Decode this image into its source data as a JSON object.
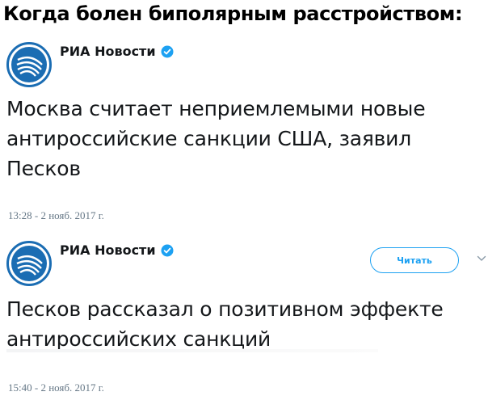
{
  "caption": "Когда болен биполярным расстройством:",
  "tweets": [
    {
      "author": "РИА Новости",
      "text": "Москва считает неприемлемыми новые антироссийские санкции США, заявил Песков",
      "timestamp": "13:28 - 2 нояб. 2017 г."
    },
    {
      "author": "РИА Новости",
      "text": "Песков рассказал о позитивном эффекте антироссийских санкций",
      "timestamp": "15:40 - 2 нояб. 2017 г.",
      "follow_label": "Читать"
    }
  ],
  "icons": {
    "avatar": "ria-novosti-logo-icon",
    "verified": "verified-badge-icon",
    "chevron": "chevron-down-icon"
  },
  "colors": {
    "logo_blue": "#1b6db3",
    "verified_blue": "#1da1f2",
    "follow_blue": "#1da1f2",
    "timestamp_gray": "#657786",
    "text_dark": "#14171a"
  }
}
